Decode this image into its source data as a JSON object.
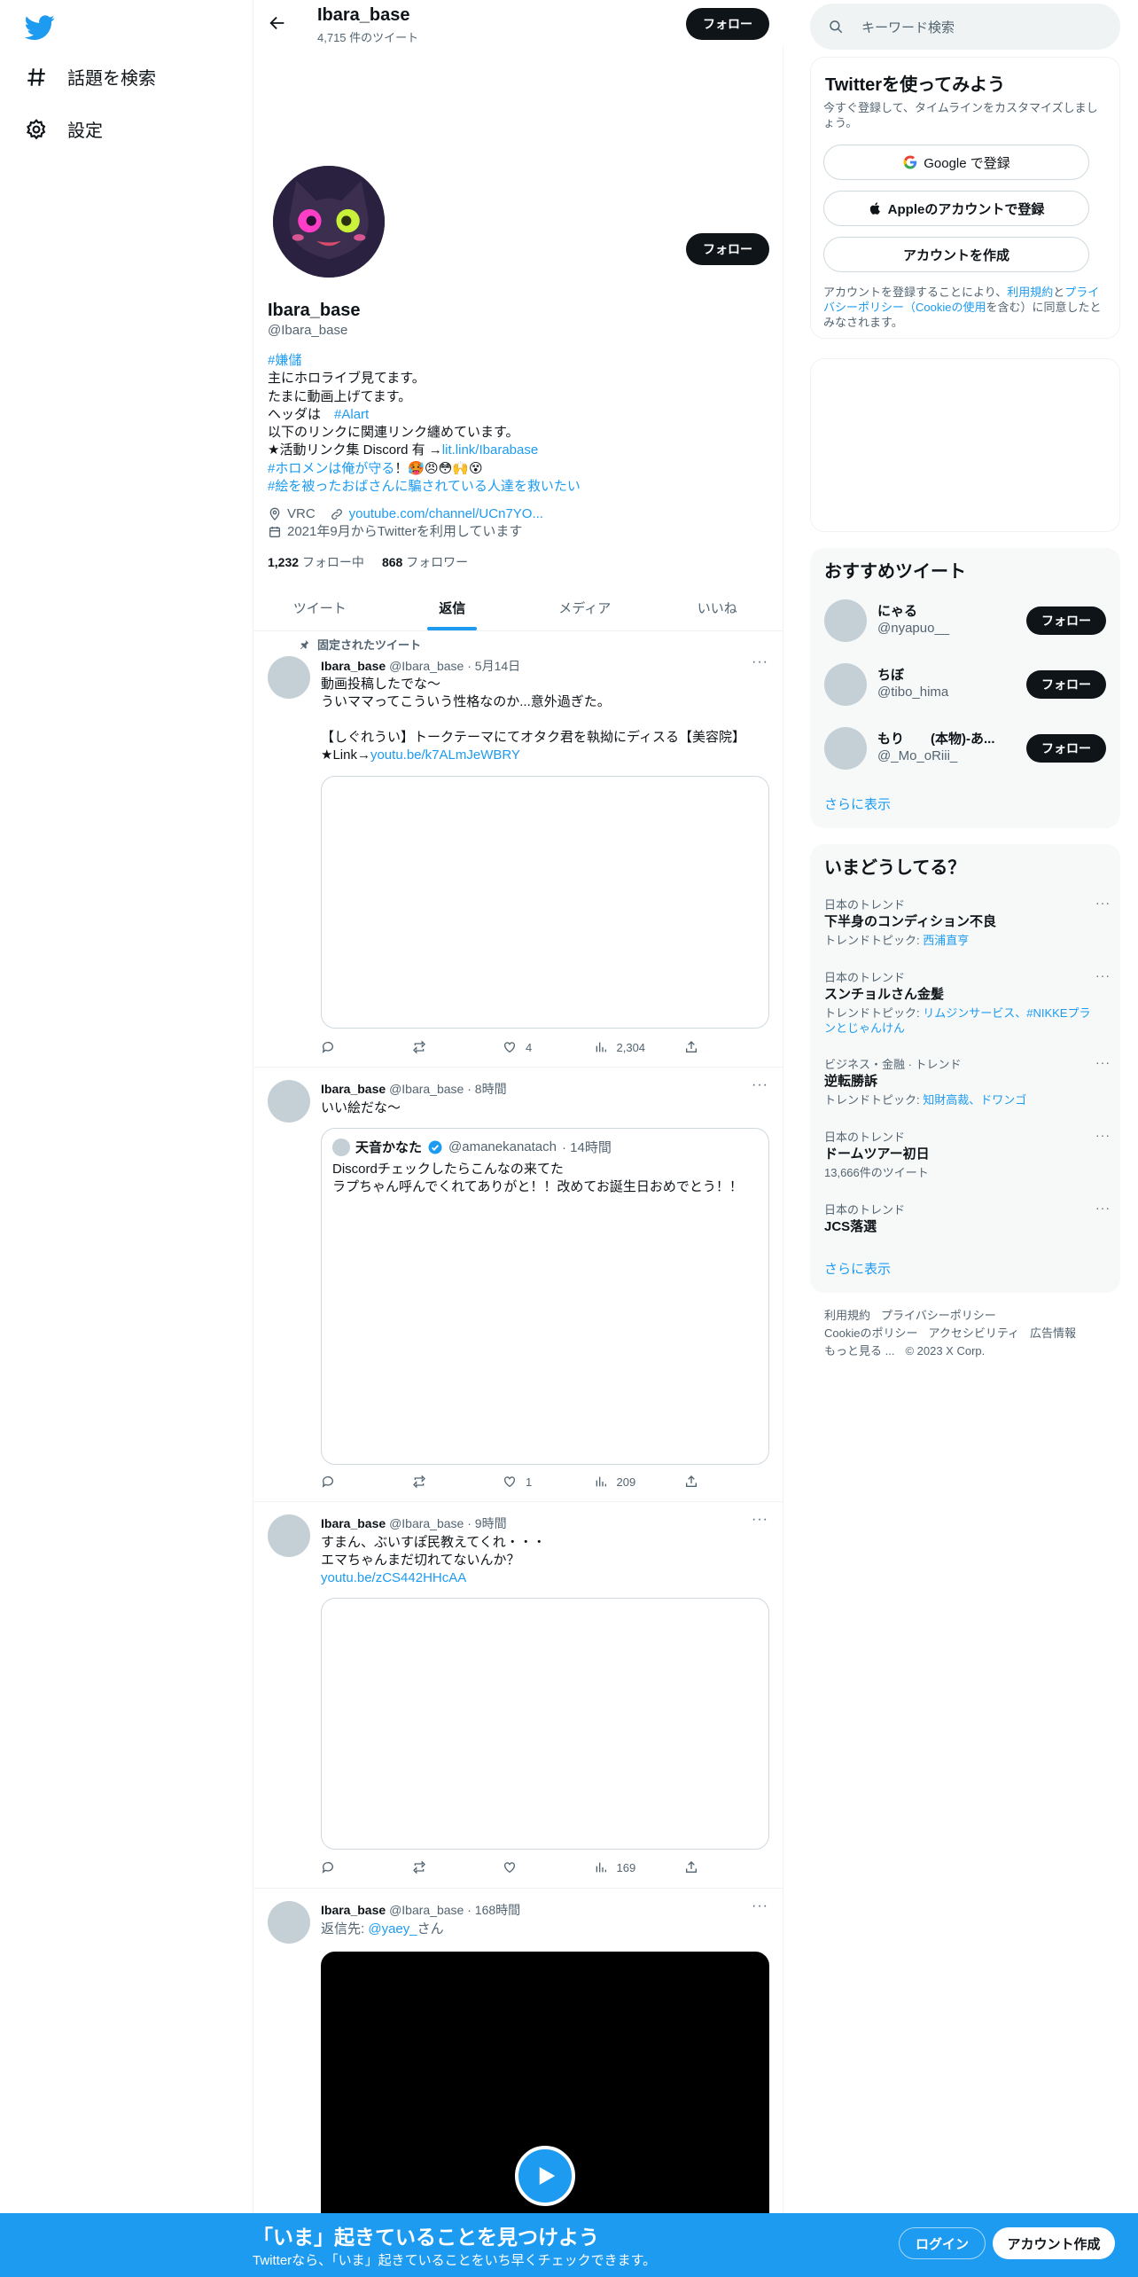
{
  "nav": {
    "explore_label": "話題を検索",
    "settings_label": "設定"
  },
  "header": {
    "name": "Ibara_base",
    "tweet_count": "4,715 件のツイート",
    "follow_label": "フォロー"
  },
  "profile": {
    "name": "Ibara_base",
    "handle": "@Ibara_base",
    "follow_label": "フォロー",
    "bio": {
      "line1": "#嫌儲",
      "line2": "主にホロライブ見てます。",
      "line3": "たまに動画上げてます。",
      "line4_pre": "ヘッダは　",
      "line4_tag": "#Alart",
      "line5": "以下のリンクに関連リンク纏めています。",
      "line6_pre": "★活動リンク集 Discord 有 →",
      "line6_link": "lit.link/Ibarabase",
      "line7_tag": "#ホロメンは俺が守る",
      "line7_rest": "！🥵😠😳🙌😵",
      "line8": "#絵を被ったおばさんに騙されている人達を救いたい"
    },
    "location": "VRC",
    "url": "youtube.com/channel/UCn7YO...",
    "joined": "2021年9月からTwitterを利用しています",
    "following_count": "1,232",
    "following_label": "フォロー中",
    "followers_count": "868",
    "followers_label": "フォロワー"
  },
  "tabs": [
    "ツイート",
    "返信",
    "メディア",
    "いいね"
  ],
  "pinned_label": "固定されたツイート",
  "tweets": [
    {
      "name": "Ibara_base",
      "handle": "@Ibara_base",
      "time": "· 5月14日",
      "lines": [
        "動画投稿したでな～",
        "ういママってこういう性格なのか...意外過ぎた。",
        "",
        "【しぐれうい】トークテーマにてオタク君を執拗にディスる【美容院】"
      ],
      "link_pre": "★Link→",
      "link": "youtu.be/k7ALmJeWBRY",
      "likes": "4",
      "views": "2,304"
    },
    {
      "name": "Ibara_base",
      "handle": "@Ibara_base",
      "time": "· 8時間",
      "text": "いい絵だな〜",
      "quote": {
        "name": "天音かなた",
        "handle": "@amanekanatach",
        "time": "· 14時間",
        "line1": "Discordチェックしたらこんなの来てた",
        "line2": "ラプちゃん呼んでくれてありがと！！改めてお誕生日おめでとう！！"
      },
      "likes": "1",
      "views": "209"
    },
    {
      "name": "Ibara_base",
      "handle": "@Ibara_base",
      "time": "· 9時間",
      "line1": "すまん、ぶいすぽ民教えてくれ・・・",
      "line2": "エマちゃんまだ切れてないんか？",
      "link": "youtu.be/zCS442HHcAA",
      "views": "169"
    },
    {
      "name": "Ibara_base",
      "handle": "@Ibara_base",
      "time": "· 168時間",
      "reply_pre": "返信先: ",
      "reply_to": "@yaey_",
      "reply_suffix": "さん"
    }
  ],
  "search": {
    "placeholder": "キーワード検索"
  },
  "signup": {
    "title": "Twitterを使ってみよう",
    "desc": "今すぐ登録して、タイムラインをカスタマイズしましょう。",
    "google": "Google で登録",
    "apple": "Appleのアカウントで登録",
    "create": "アカウントを作成",
    "terms_pre": "アカウントを登録することにより、",
    "terms_link1": "利用規約",
    "terms_mid": "と",
    "terms_link2": "プライバシーポリシー（Cookieの使用",
    "terms_post": "を含む）に同意したとみなされます。"
  },
  "recommend": {
    "title": "おすすめツイート",
    "users": [
      {
        "name": "にゃる",
        "handle": "@nyapuo__"
      },
      {
        "name": "ちぼ",
        "handle": "@tibo_hima"
      },
      {
        "name": "もり　　(本物)-あ...",
        "handle": "@_Mo_oRiii_"
      }
    ],
    "follow_label": "フォロー",
    "show_more": "さらに表示"
  },
  "trends": {
    "title": "いまどうしてる？",
    "items": [
      {
        "category": "日本のトレンド",
        "title": "下半身のコンディション不良",
        "sub_pre": "トレンドトピック: ",
        "sub_link": "西浦直亨"
      },
      {
        "category": "日本のトレンド",
        "title": "スンチョルさん金髪",
        "sub_pre": "トレンドトピック: ",
        "sub_link": "リムジンサービス、#NIKKEプランとじゃんけん"
      },
      {
        "category": "ビジネス・金融 · トレンド",
        "title": "逆転勝訴",
        "sub_pre": "トレンドトピック: ",
        "sub_link": "知財高裁、ドワンゴ"
      },
      {
        "category": "日本のトレンド",
        "title": "ドームツアー初日",
        "sub_pre": "13,666件のツイート",
        "sub_link": ""
      },
      {
        "category": "日本のトレンド",
        "title": "JCS落選",
        "sub_pre": "",
        "sub_link": ""
      }
    ],
    "show_more": "さらに表示"
  },
  "footer": {
    "terms": "利用規約",
    "privacy": "プライバシーポリシー",
    "cookie": "Cookieのポリシー",
    "accessibility": "アクセシビリティ",
    "ads": "広告情報",
    "more": "もっと見る ...",
    "copyright": "© 2023 X Corp."
  },
  "bottom_bar": {
    "title": "「いま」起きていることを見つけよう",
    "subtitle": "Twitterなら、「いま」起きていることをいち早くチェックできます。",
    "login": "ログイン",
    "signup": "アカウント作成"
  },
  "colors": {
    "accent": "#1d9bf0",
    "text": "#0f1419",
    "muted": "#536471"
  }
}
